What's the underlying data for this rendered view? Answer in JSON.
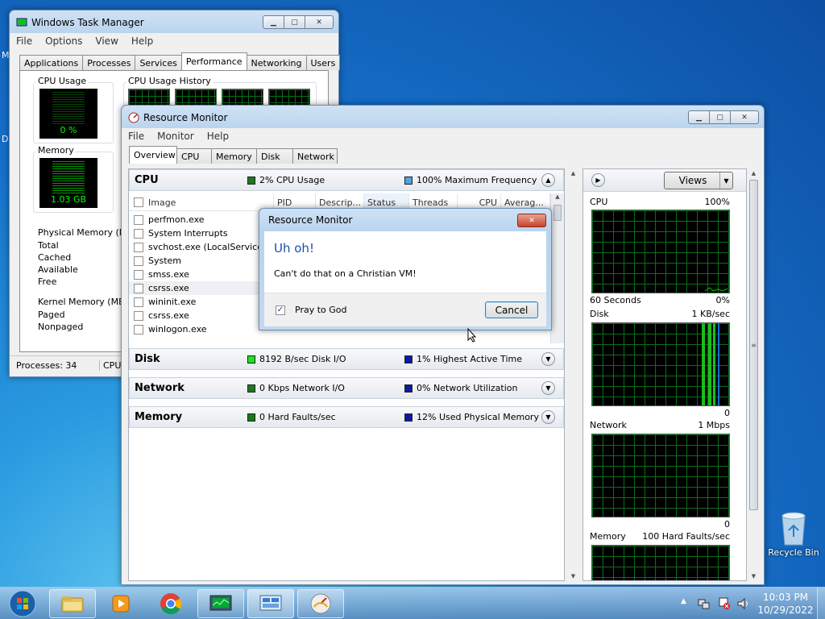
{
  "desktop": {
    "recycle_bin_label": "Recycle Bin"
  },
  "task_manager": {
    "title": "Windows Task Manager",
    "menu": [
      "File",
      "Options",
      "View",
      "Help"
    ],
    "tabs": [
      "Applications",
      "Processes",
      "Services",
      "Performance",
      "Networking",
      "Users"
    ],
    "active_tab": "Performance",
    "cpu_usage_label": "CPU Usage",
    "cpu_usage_value": "0 %",
    "cpu_history_label": "CPU Usage History",
    "memory_label": "Memory",
    "memory_value": "1.03 GB",
    "physical_memory_label": "Physical Memory (MB)",
    "physical_rows": [
      "Total",
      "Cached",
      "Available",
      "Free"
    ],
    "kernel_memory_label": "Kernel Memory (MB)",
    "kernel_rows": [
      "Paged",
      "Nonpaged"
    ],
    "status_processes": "Processes: 34",
    "status_cpu": "CPU"
  },
  "resource_monitor": {
    "title": "Resource Monitor",
    "menu": [
      "File",
      "Monitor",
      "Help"
    ],
    "tabs": [
      "Overview",
      "CPU",
      "Memory",
      "Disk",
      "Network"
    ],
    "active_tab": "Overview",
    "sections": {
      "cpu": {
        "name": "CPU",
        "stat1": "2% CPU Usage",
        "stat2": "100% Maximum Frequency"
      },
      "disk": {
        "name": "Disk",
        "stat1": "8192 B/sec Disk I/O",
        "stat2": "1% Highest Active Time"
      },
      "network": {
        "name": "Network",
        "stat1": "0 Kbps Network I/O",
        "stat2": "0% Network Utilization"
      },
      "memory": {
        "name": "Memory",
        "stat1": "0 Hard Faults/sec",
        "stat2": "12% Used Physical Memory"
      }
    },
    "columns": [
      "Image",
      "PID",
      "Descrip...",
      "Status",
      "Threads",
      "CPU",
      "Averag..."
    ],
    "processes": [
      "perfmon.exe",
      "System Interrupts",
      "svchost.exe (LocalServiceNo",
      "System",
      "smss.exe",
      "csrss.exe",
      "wininit.exe",
      "csrss.exe",
      "winlogon.exe"
    ],
    "views_button": "Views",
    "graphs": {
      "cpu": {
        "title": "CPU",
        "max": "100%",
        "footer_left": "60 Seconds",
        "footer_right": "0%"
      },
      "disk": {
        "title": "Disk",
        "max": "1 KB/sec",
        "footer_right": "0"
      },
      "network": {
        "title": "Network",
        "max": "1 Mbps",
        "footer_right": "0"
      },
      "memory": {
        "title": "Memory",
        "max": "100 Hard Faults/sec"
      }
    }
  },
  "dialog": {
    "title": "Resource Monitor",
    "heading": "Uh oh!",
    "message": "Can't do that on a Christian VM!",
    "checkbox_label": "Pray to God",
    "checkbox_checked": true,
    "cancel_button": "Cancel"
  },
  "taskbar": {
    "clock_time": "10:03 PM",
    "clock_date": "10/29/2022"
  },
  "colors": {
    "graph_green": "#00c000",
    "cpu_green": "#1a7a1a",
    "freq_blue": "#4da3e8",
    "disk_green": "#22e022",
    "stat_blue": "#0a1aa8",
    "dialog_heading": "#1d4fa6"
  }
}
